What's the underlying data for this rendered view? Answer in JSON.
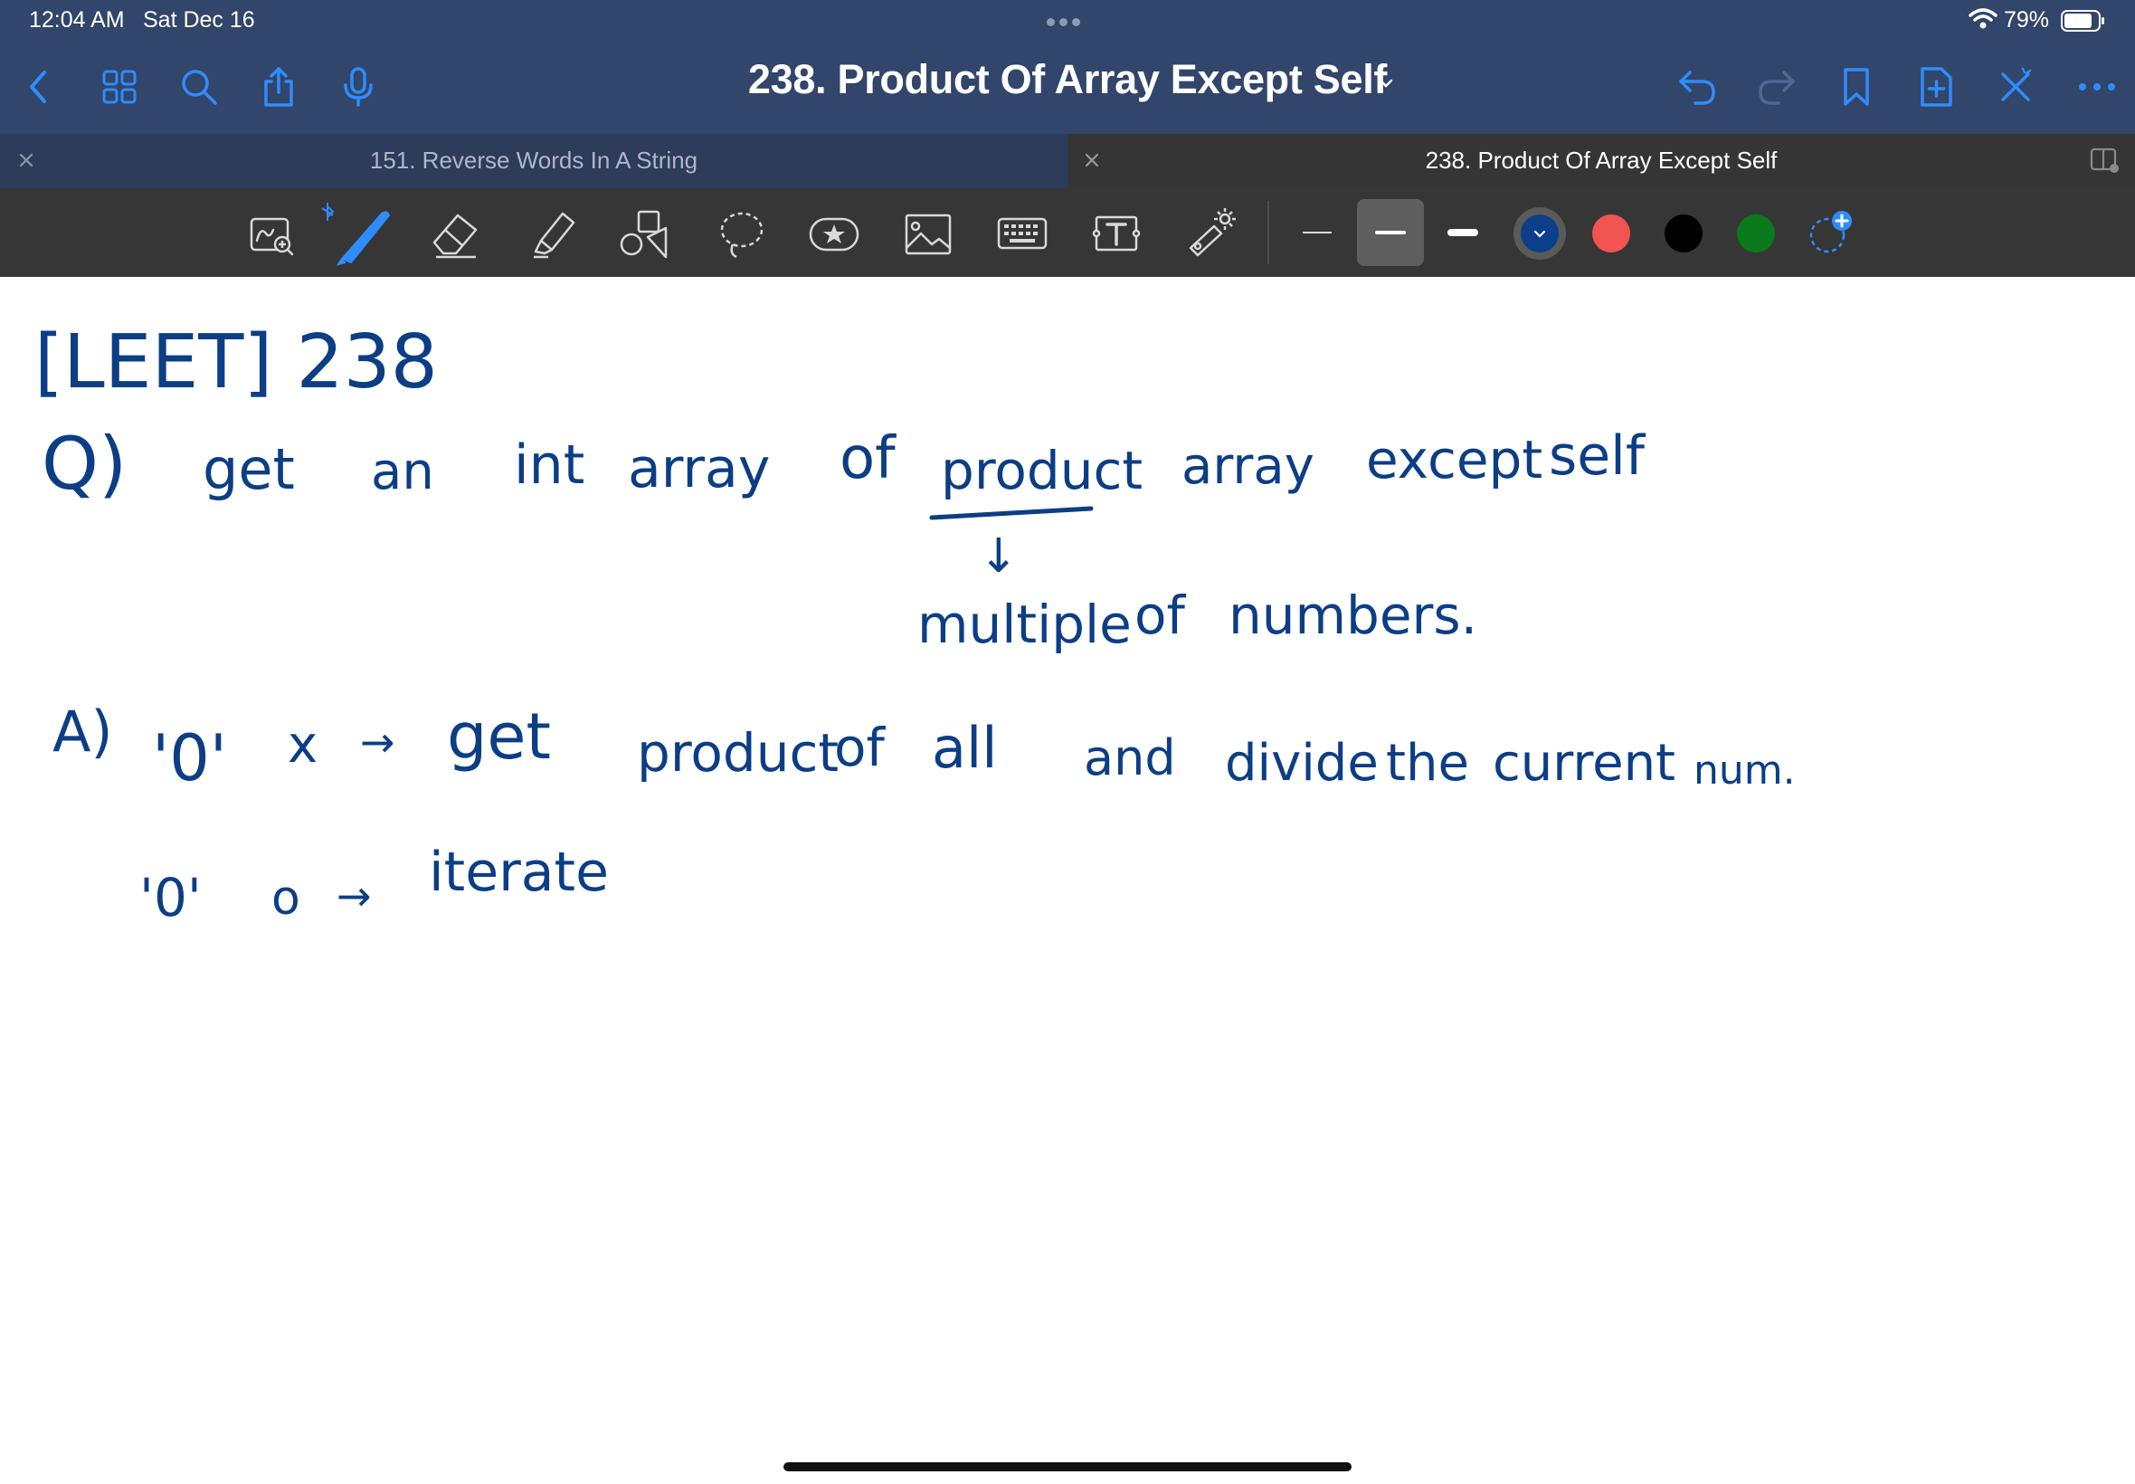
{
  "status_bar": {
    "time": "12:04 AM",
    "date": "Sat Dec 16",
    "battery": "79%"
  },
  "title_bar": {
    "title": "238. Product Of Array Except Self",
    "accent_color": "#2f8cff",
    "background": "#32456a",
    "left_icons": [
      "back-chevron-icon",
      "grid-icon",
      "search-icon",
      "share-icon",
      "microphone-icon"
    ],
    "right_icons": [
      "undo-icon",
      "redo-icon",
      "bookmark-icon",
      "add-page-icon",
      "close-x-icon",
      "more-icon"
    ]
  },
  "tabs": [
    {
      "label": "151. Reverse Words In A String",
      "active": false
    },
    {
      "label": "238. Product Of Array Except Self",
      "active": true
    }
  ],
  "toolbar": {
    "tools": [
      "zoom-box-icon",
      "pen-icon",
      "eraser-icon",
      "highlighter-icon",
      "shapes-icon",
      "lasso-icon",
      "sticker-icon",
      "image-icon",
      "keyboard-icon",
      "text-box-icon",
      "laser-pointer-icon"
    ],
    "stroke_widths": [
      "thin",
      "medium",
      "thick"
    ],
    "selected_stroke": "medium",
    "colors": [
      "#0b3f8a",
      "#f25451",
      "#000000",
      "#0b7a1c"
    ],
    "selected_color": "#0b3f8a"
  },
  "note": {
    "ink_color": "#0c3e85",
    "line1": "[LEET] 238",
    "q_prefix": "Q)",
    "q_words": [
      "get",
      "an",
      "int",
      "array",
      "of",
      "product",
      "array",
      "except",
      "self"
    ],
    "arrow_glyph": "↓",
    "definition": [
      "multiple",
      "of",
      "numbers."
    ],
    "a_prefix": "A)",
    "a_line1": [
      "'0'",
      "x",
      "→",
      "get",
      "product",
      "of",
      "all",
      "and",
      "divide",
      "the",
      "current",
      "num."
    ],
    "a_line2": [
      "'0'",
      "o",
      "→",
      "iterate"
    ]
  }
}
